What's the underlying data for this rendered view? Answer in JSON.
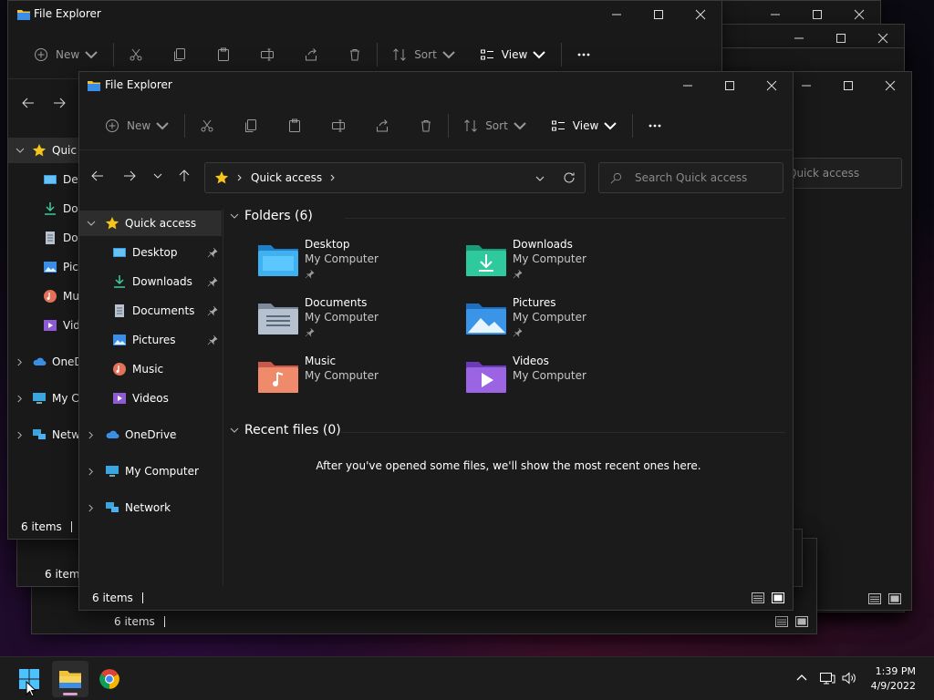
{
  "app_title": "File Explorer",
  "toolbar": {
    "new_label": "New",
    "sort_label": "Sort",
    "view_label": "View"
  },
  "address": {
    "crumb": "Quick access"
  },
  "search": {
    "placeholder": "Search Quick access",
    "back_placeholder": "Quick access"
  },
  "sidebar": {
    "quick_access": "Quick access",
    "items": [
      {
        "label": "Desktop",
        "icon": "desktop-icon",
        "pinned": true
      },
      {
        "label": "Downloads",
        "icon": "download-icon",
        "pinned": true
      },
      {
        "label": "Documents",
        "icon": "document-icon",
        "pinned": true
      },
      {
        "label": "Pictures",
        "icon": "picture-icon",
        "pinned": true
      },
      {
        "label": "Music",
        "icon": "music-icon",
        "pinned": false
      },
      {
        "label": "Videos",
        "icon": "video-icon",
        "pinned": false
      }
    ],
    "onedrive": "OneDrive",
    "my_computer": "My Computer",
    "network": "Network",
    "back_truncated": [
      "Quic",
      "Des",
      "Dov",
      "Doc",
      "Pict",
      "Mu",
      "Vide",
      "OneD",
      "My C",
      "Netw"
    ]
  },
  "content": {
    "folders_header": "Folders (6)",
    "folders": [
      {
        "name": "Desktop",
        "location": "My Computer",
        "pinned": true
      },
      {
        "name": "Downloads",
        "location": "My Computer",
        "pinned": true
      },
      {
        "name": "Documents",
        "location": "My Computer",
        "pinned": true
      },
      {
        "name": "Pictures",
        "location": "My Computer",
        "pinned": true
      },
      {
        "name": "Music",
        "location": "My Computer",
        "pinned": false
      },
      {
        "name": "Videos",
        "location": "My Computer",
        "pinned": false
      }
    ],
    "recent_header": "Recent files (0)",
    "recent_empty": "After you've opened some files, we'll show the most recent ones here."
  },
  "status": {
    "items_count": "6 items"
  },
  "taskbar": {
    "apps": [
      "start",
      "file-explorer",
      "chrome"
    ],
    "time": "1:39 PM",
    "date": "4/9/2022"
  },
  "colors": {
    "window_bg": "#191919",
    "taskbar_bg": "#1c1c1c",
    "accent_star": "#f5c518",
    "active_indicator": "#d9a1d0"
  }
}
